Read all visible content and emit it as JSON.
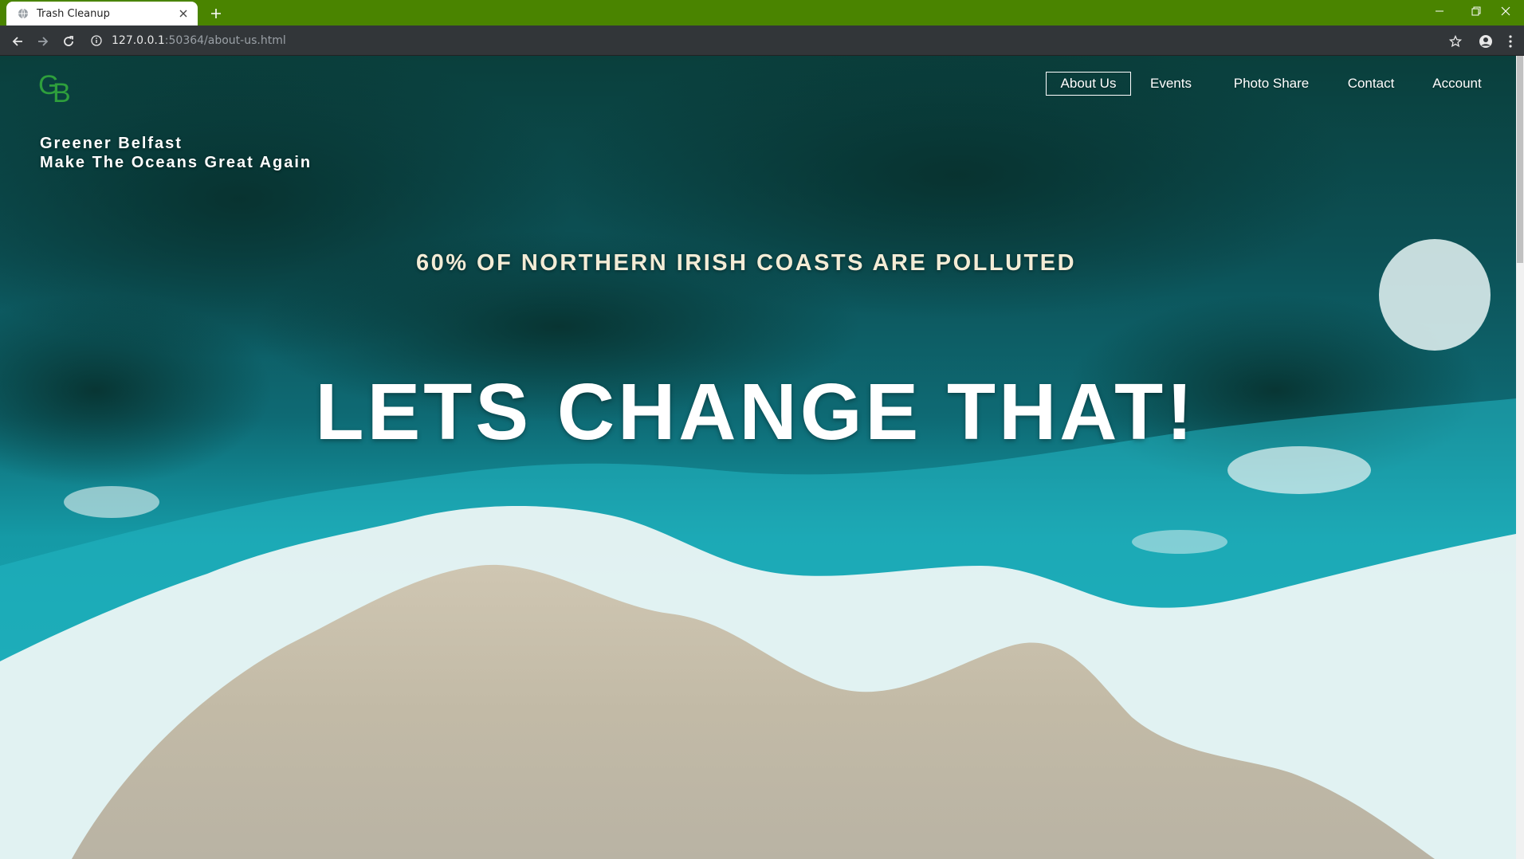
{
  "browser": {
    "tab_title": "Trash Cleanup",
    "url_host": "127.0.0.1",
    "url_rest": ":50364/about-us.html",
    "accent_color": "#4a8400"
  },
  "site": {
    "logo_text": "GB",
    "brand_line1": "Greener Belfast",
    "brand_line2": "Make The Oceans Great Again",
    "nav": [
      {
        "label": "About Us",
        "active": true
      },
      {
        "label": "Events",
        "active": false
      },
      {
        "label": "Photo Share",
        "active": false
      },
      {
        "label": "Contact",
        "active": false
      },
      {
        "label": "Account",
        "active": false
      }
    ],
    "stat_heading": "60% OF NORTHERN IRISH COASTS ARE POLLUTED",
    "cta_heading": "LETS CHANGE THAT!"
  },
  "icons": {
    "favicon": "globe-icon",
    "close": "close-icon",
    "new_tab": "plus-icon",
    "back": "arrow-left-icon",
    "forward": "arrow-right-icon",
    "reload": "reload-icon",
    "info": "info-icon",
    "bookmark": "star-icon",
    "profile": "profile-icon",
    "menu": "kebab-menu-icon"
  }
}
